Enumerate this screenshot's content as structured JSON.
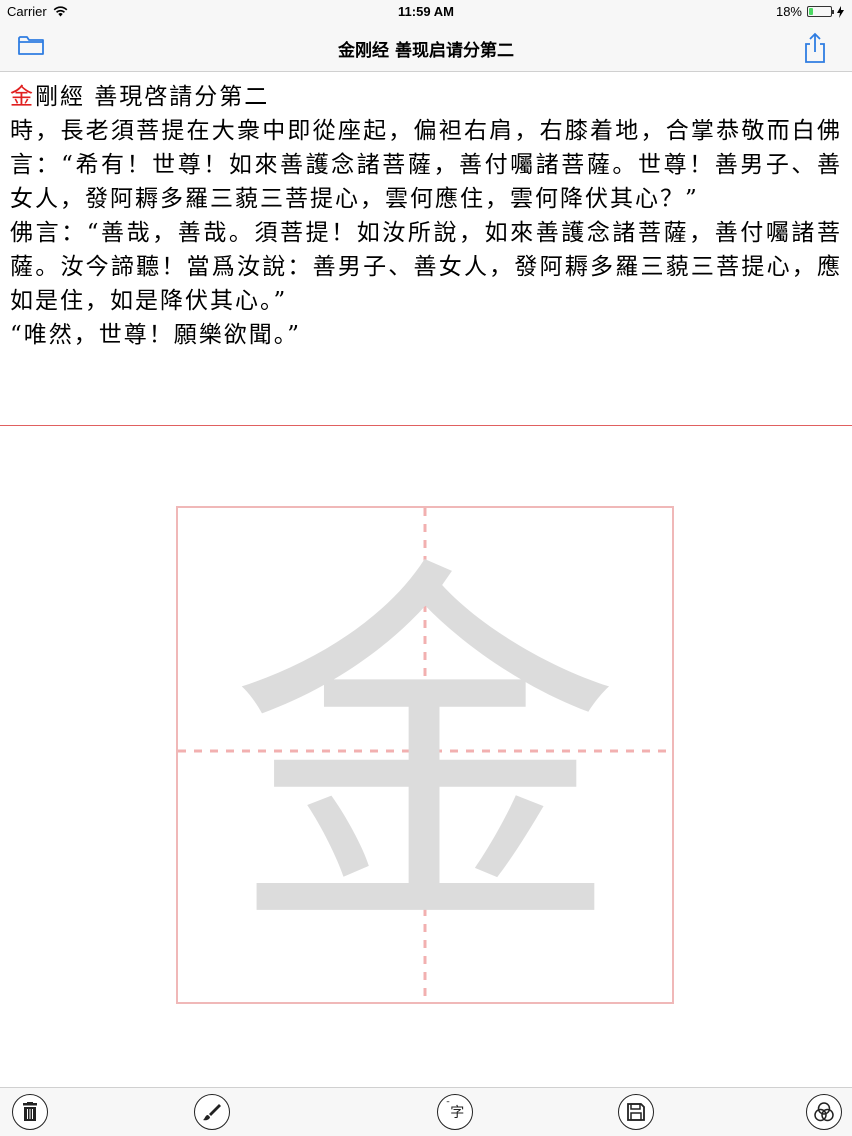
{
  "status_bar": {
    "carrier": "Carrier",
    "time": "11:59 AM",
    "battery": "18%",
    "battery_level": 0.18
  },
  "nav": {
    "title": "金刚经 善现启请分第二",
    "left_icon": "folder-icon",
    "right_icon": "share-icon"
  },
  "text": {
    "title_highlight": "金",
    "title_rest": "剛經 善現啓請分第二",
    "paragraphs": [
      "時，長老須菩提在大衆中即從座起，偏袒右肩，右膝着地，合掌恭敬而白佛言：“希有！世尊！如來善護念諸菩薩，善付囑諸菩薩。世尊！善男子、善女人，發阿耨多羅三藐三菩提心，雲何應住，雲何降伏其心？”",
      "佛言：“善哉，善哉。須菩提！如汝所說，如來善護念諸菩薩，善付囑諸菩薩。汝今諦聽！當爲汝說：善男子、善女人，發阿耨多羅三藐三菩提心，應如是住，如是降伏其心。”",
      "“唯然，世尊！願樂欲聞。”"
    ]
  },
  "practice": {
    "model_char": "金",
    "grid_color": "#f0b8b8"
  },
  "toolbar": {
    "single_char_label": "字",
    "icons": [
      "trash-icon",
      "brush-icon",
      "single-char-icon",
      "save-icon",
      "overlap-circles-icon"
    ]
  },
  "colors": {
    "accent": "#2f7de1",
    "highlight": "#e02020",
    "divider": "#e06060"
  }
}
